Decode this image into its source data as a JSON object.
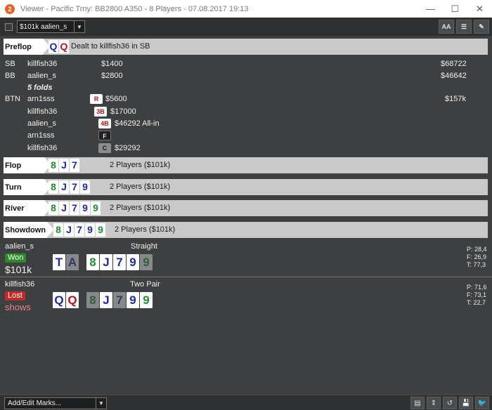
{
  "window": {
    "title": "Viewer - Pacific Trny: BB2800 A350 - 8 Players - 07.08.2017 19:13",
    "controls": {
      "minimize": "—",
      "maximize": "☐",
      "close": "✕"
    }
  },
  "toolbar": {
    "player_select": "$101k aalien_s",
    "font_button": "AA",
    "list_button": "☰",
    "edit_button": "✎"
  },
  "preflop": {
    "label": "Preflop",
    "cards": [
      {
        "rank": "Q",
        "color": "blue"
      },
      {
        "rank": "Q",
        "color": "red"
      }
    ],
    "info": "Dealt to killfish36 in SB",
    "rows": [
      {
        "pos": "SB",
        "player": "killfish36",
        "amount": "$1400",
        "stack": "$68722"
      },
      {
        "pos": "BB",
        "player": "aalien_s",
        "amount": "$2800",
        "stack": "$46642"
      }
    ],
    "folds": "5 folds",
    "actions": [
      {
        "pos": "BTN",
        "player": "arn1sss",
        "tag": "R",
        "amount": "$5600",
        "stack": "$157k",
        "kind": "raise"
      },
      {
        "pos": "",
        "player": "killfish36",
        "tag": "3B",
        "amount": "$17000",
        "stack": "",
        "kind": "raise"
      },
      {
        "pos": "",
        "player": "aalien_s",
        "tag": "4B",
        "amount": "$46292 All-in",
        "stack": "",
        "kind": "raise"
      },
      {
        "pos": "",
        "player": "arn1sss",
        "tag": "F",
        "amount": "",
        "stack": "",
        "kind": "fold"
      },
      {
        "pos": "",
        "player": "killfish36",
        "tag": "C",
        "amount": "$29292",
        "stack": "",
        "kind": "call"
      }
    ]
  },
  "streets": [
    {
      "label": "Flop",
      "cards": [
        {
          "rank": "8",
          "color": "green"
        },
        {
          "rank": "J",
          "color": "blue"
        },
        {
          "rank": "7",
          "color": "blue"
        }
      ],
      "info": "2 Players ($101k)"
    },
    {
      "label": "Turn",
      "cards": [
        {
          "rank": "8",
          "color": "green"
        },
        {
          "rank": "J",
          "color": "blue"
        },
        {
          "rank": "7",
          "color": "blue"
        },
        {
          "rank": "9",
          "color": "blue"
        }
      ],
      "info": "2 Players ($101k)"
    },
    {
      "label": "River",
      "cards": [
        {
          "rank": "8",
          "color": "green"
        },
        {
          "rank": "J",
          "color": "blue"
        },
        {
          "rank": "7",
          "color": "blue"
        },
        {
          "rank": "9",
          "color": "blue"
        },
        {
          "rank": "9",
          "color": "green"
        }
      ],
      "info": "2 Players ($101k)"
    },
    {
      "label": "Showdown",
      "cards": [
        {
          "rank": "8",
          "color": "green"
        },
        {
          "rank": "J",
          "color": "blue"
        },
        {
          "rank": "7",
          "color": "blue"
        },
        {
          "rank": "9",
          "color": "blue"
        },
        {
          "rank": "9",
          "color": "green"
        }
      ],
      "info": "2 Players ($101k)"
    }
  ],
  "showdown": [
    {
      "player": "aalien_s",
      "hand": "Straight",
      "result": "Won",
      "amount": "$101k",
      "hole": [
        {
          "rank": "T",
          "color": "blue",
          "dim": false
        },
        {
          "rank": "A",
          "color": "blue",
          "dim": true
        }
      ],
      "board": [
        {
          "rank": "8",
          "color": "green",
          "dim": false
        },
        {
          "rank": "J",
          "color": "blue",
          "dim": false
        },
        {
          "rank": "7",
          "color": "blue",
          "dim": false
        },
        {
          "rank": "9",
          "color": "blue",
          "dim": false
        },
        {
          "rank": "9",
          "color": "green",
          "dim": true
        }
      ],
      "stats": [
        "P: 28,4",
        "F: 26,9",
        "T: 77,3"
      ]
    },
    {
      "player": "killfish36",
      "hand": "Two Pair",
      "result": "Lost",
      "amount": "shows",
      "hole": [
        {
          "rank": "Q",
          "color": "blue",
          "dim": false
        },
        {
          "rank": "Q",
          "color": "red",
          "dim": false
        }
      ],
      "board": [
        {
          "rank": "8",
          "color": "green",
          "dim": true
        },
        {
          "rank": "J",
          "color": "blue",
          "dim": false
        },
        {
          "rank": "7",
          "color": "blue",
          "dim": true
        },
        {
          "rank": "9",
          "color": "blue",
          "dim": false
        },
        {
          "rank": "9",
          "color": "green",
          "dim": false
        }
      ],
      "stats": [
        "P: 71,6",
        "F: 73,1",
        "T: 22,7"
      ]
    }
  ],
  "statusbar": {
    "marks_label": "Add/Edit Marks...",
    "buttons": [
      "▤",
      "⇕",
      "↺",
      "💾",
      "🐦"
    ]
  },
  "colors": {
    "blue": "#1b2aa6",
    "red": "#b1121e",
    "green": "#1e8f2e",
    "won": "#2c8a28",
    "lost": "#c42a2a",
    "accent": "#e8622a"
  }
}
